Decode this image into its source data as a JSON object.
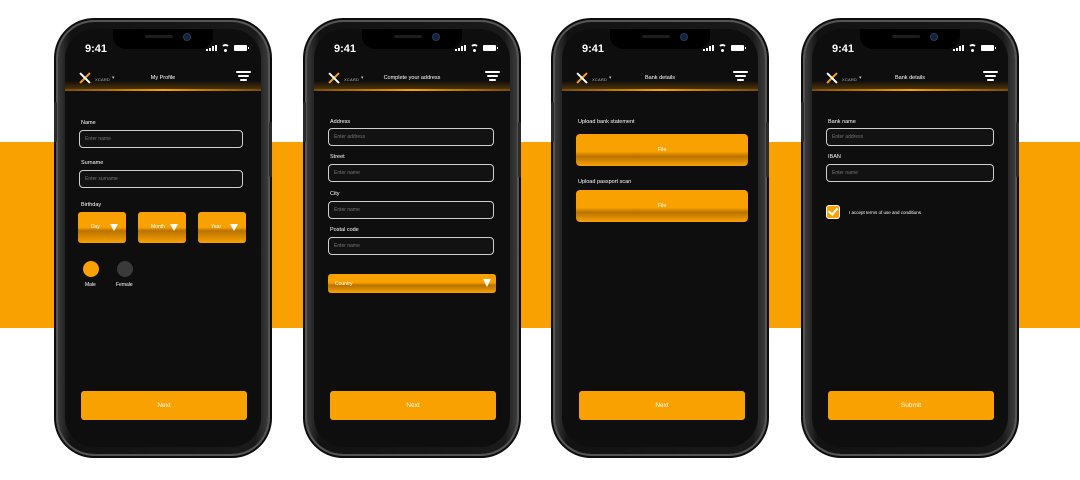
{
  "colors": {
    "accent": "#F9A100",
    "screen_bg": "#0e0e0e",
    "page_bg": "#ffffff"
  },
  "status_bar": {
    "time": "9:41"
  },
  "brand": "XCARD",
  "screens": [
    {
      "title": "My Profile",
      "name_label": "Name",
      "name_placeholder": "Enter name",
      "surname_label": "Surname",
      "surname_placeholder": "Enter surname",
      "birthday_label": "Birthday",
      "day": "Day",
      "month": "Month",
      "year": "Year",
      "gender_male": "Male",
      "gender_female": "Female",
      "gender_selected": "Male",
      "button": "Next"
    },
    {
      "title": "Complete your address",
      "address_label": "Address",
      "address_placeholder": "Enter address",
      "street_label": "Street",
      "street_placeholder": "Enter name",
      "city_label": "City",
      "city_placeholder": "Enter name",
      "postal_label": "Postal code",
      "postal_placeholder": "Enter name",
      "country": "Country",
      "button": "Next"
    },
    {
      "title": "Bank details",
      "statement_label": "Upload bank statement",
      "statement_file": "File",
      "passport_label": "Upload passport scan",
      "passport_file": "File",
      "button": "Next"
    },
    {
      "title": "Bank details",
      "bank_label": "Bank name",
      "bank_placeholder": "Enter address",
      "iban_label": "IBAN",
      "iban_placeholder": "Enter name",
      "terms": "I accept terms of use and conditions",
      "terms_checked": true,
      "button": "Submit"
    }
  ]
}
